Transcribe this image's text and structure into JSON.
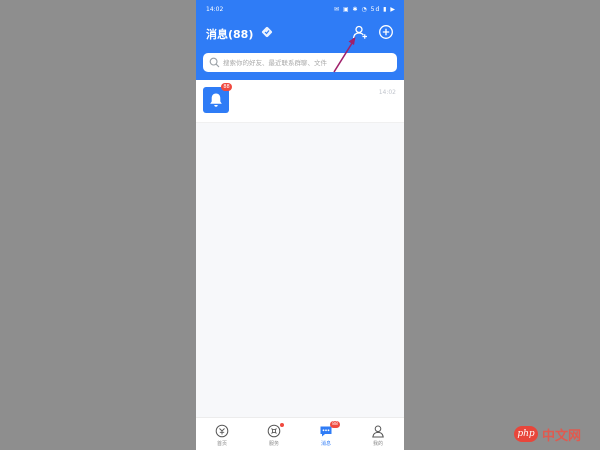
{
  "status_bar": {
    "time": "14:02",
    "icons": "✉ ▣ ✱ ◔ 5d ▮ ▶"
  },
  "header": {
    "title": "消息(88)"
  },
  "search": {
    "placeholder": "搜索你的好友、最近联系群聊、文件"
  },
  "messages": [
    {
      "badge": "88",
      "time": "14:02"
    }
  ],
  "tabs": [
    {
      "label": "首页",
      "icon": "home-icon"
    },
    {
      "label": "服务",
      "icon": "service-icon"
    },
    {
      "label": "消息",
      "icon": "message-icon",
      "badge": "88",
      "active": true
    },
    {
      "label": "我的",
      "icon": "profile-icon"
    }
  ],
  "watermark": {
    "logo": "php",
    "text": "中文网"
  },
  "colors": {
    "brand": "#2f7cf6",
    "badge": "#f0493f",
    "background": "#8e8e8e"
  }
}
